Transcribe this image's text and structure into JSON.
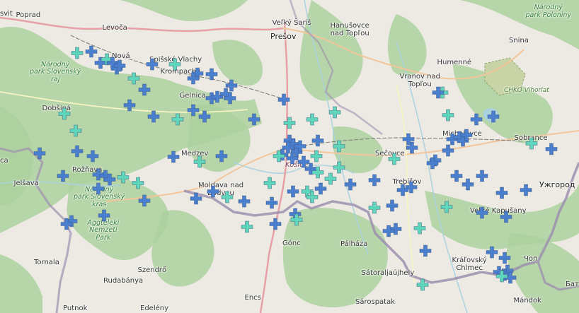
{
  "map": {
    "place_labels": [
      {
        "text": "Poprad",
        "kind": "town"
      },
      {
        "text": "svit",
        "kind": "town"
      },
      {
        "text": "Levoča",
        "kind": "town"
      },
      {
        "text": "Veľký Šariš",
        "kind": "town"
      },
      {
        "text": "Prešov",
        "kind": "big"
      },
      {
        "text": "Hanušovce\nnad Topľou",
        "kind": "town"
      },
      {
        "text": "Snina",
        "kind": "town"
      },
      {
        "text": "Národný\npark Poloniny",
        "kind": "park"
      },
      {
        "text": "Humenné",
        "kind": "town"
      },
      {
        "text": "Vranov nad\nTopľou",
        "kind": "town"
      },
      {
        "text": "CHKO Vihorlat",
        "kind": "chko"
      },
      {
        "text": "Národný\npark Slovenský\nraj",
        "kind": "park"
      },
      {
        "text": "Nová",
        "kind": "town"
      },
      {
        "text": "Spišské Vlachy",
        "kind": "town"
      },
      {
        "text": "Krompachy",
        "kind": "town"
      },
      {
        "text": "Gelnica",
        "kind": "town"
      },
      {
        "text": "Dobšiná",
        "kind": "town"
      },
      {
        "text": "Medzev",
        "kind": "town"
      },
      {
        "text": "Košice",
        "kind": "city"
      },
      {
        "text": "Sečovce",
        "kind": "town"
      },
      {
        "text": "Michalovce",
        "kind": "town"
      },
      {
        "text": "Sobrance",
        "kind": "town"
      },
      {
        "text": "Rožňava",
        "kind": "town"
      },
      {
        "text": "Jelšava",
        "kind": "town"
      },
      {
        "text": "Národný\npark Slovenský\nkras",
        "kind": "park"
      },
      {
        "text": "Moldava nad\nBodvou",
        "kind": "town"
      },
      {
        "text": "Trebišov",
        "kind": "town"
      },
      {
        "text": "Ужгород",
        "kind": "big"
      },
      {
        "text": "Veľké Kapušany",
        "kind": "town"
      },
      {
        "text": "Aggteleki\nNemzeti\nPark",
        "kind": "park"
      },
      {
        "text": "Tornala",
        "kind": "town"
      },
      {
        "text": "Szendrő",
        "kind": "town"
      },
      {
        "text": "Gönc",
        "kind": "town"
      },
      {
        "text": "Pálháza",
        "kind": "town"
      },
      {
        "text": "Sátoraljaújhely",
        "kind": "town"
      },
      {
        "text": "Kráľovský\nChlmec",
        "kind": "town"
      },
      {
        "text": "Чоп",
        "kind": "town"
      },
      {
        "text": "Rudabánya",
        "kind": "town"
      },
      {
        "text": "Encs",
        "kind": "town"
      },
      {
        "text": "Sárospatak",
        "kind": "town"
      },
      {
        "text": "Mándok",
        "kind": "town"
      },
      {
        "text": "Бат",
        "kind": "town"
      },
      {
        "text": "Putnok",
        "kind": "town"
      },
      {
        "text": "Edelény",
        "kind": "town"
      },
      {
        "text": "ca",
        "kind": "town"
      }
    ],
    "colors": {
      "land": "#eceae3",
      "forest": "#add19e",
      "marker_blue": "#4a7fd0",
      "marker_teal": "#5ed6bc",
      "border": "#9e8fb0",
      "primary_road": "#e8a0a8",
      "water": "#aad3df"
    },
    "marker_icon": "plus-cross-icon"
  }
}
